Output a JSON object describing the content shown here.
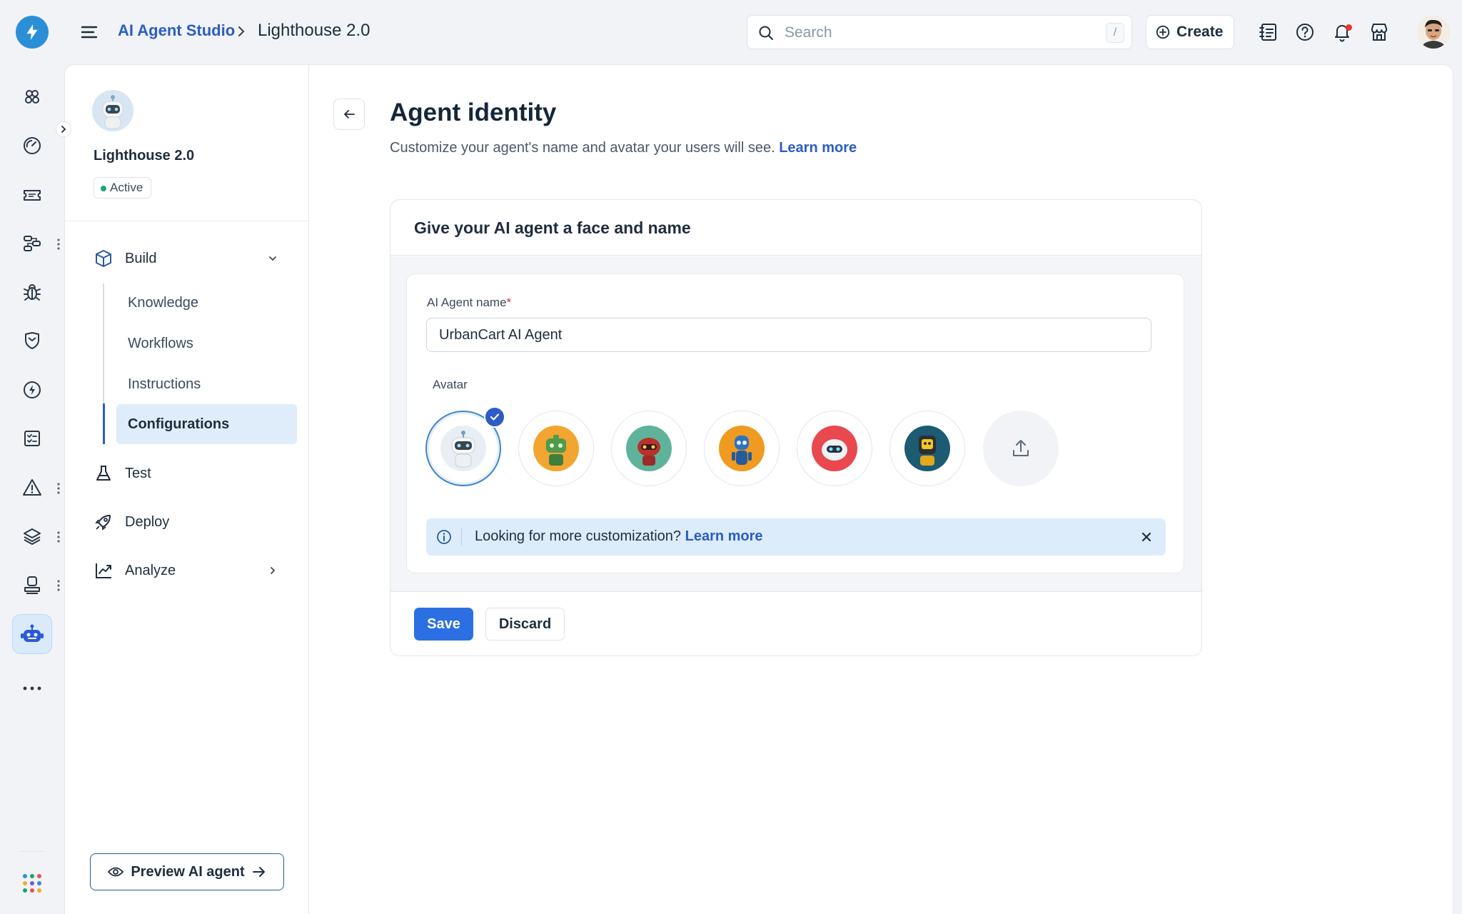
{
  "app": {
    "title": "AI Agent Studio",
    "breadcrumb_current": "Lighthouse 2.0",
    "brand_color": "#2b8fd8",
    "accent_color": "#2c5cc5"
  },
  "topbar": {
    "search_placeholder": "Search",
    "search_shortcut": "/",
    "create_label": "Create",
    "icons": [
      "contacts-icon",
      "help-icon",
      "bell-icon",
      "store-icon"
    ]
  },
  "rail": {
    "icons": [
      "integrations-icon",
      "dashboard-icon",
      "tickets-icon",
      "workflow-icon",
      "bug-icon",
      "shield-icon",
      "billing-icon",
      "tasks-icon",
      "alert-icon",
      "layers-icon",
      "stamp-icon",
      "bot-icon",
      "more-icon"
    ],
    "active": "bot-icon"
  },
  "agent": {
    "name": "Lighthouse 2.0",
    "status": "Active",
    "status_color": "#17a577"
  },
  "subnav": {
    "build": "Build",
    "items": [
      "Knowledge",
      "Workflows",
      "Instructions",
      "Configurations"
    ],
    "active_item": "Configurations",
    "test": "Test",
    "deploy": "Deploy",
    "analyze": "Analyze",
    "preview_button": "Preview AI agent"
  },
  "page": {
    "title": "Agent identity",
    "subtitle": "Customize your agent's name and avatar your users will see.",
    "subtitle_link": "Learn more"
  },
  "card": {
    "header": "Give your AI agent a face and name",
    "name_label": "AI Agent name",
    "required_mark": "*",
    "name_value": "UrbanCart AI Agent",
    "avatar_label": "Avatar",
    "avatars": [
      {
        "name": "white-robot",
        "color": "#e8eef4",
        "selected": true
      },
      {
        "name": "green-robot",
        "color": "#f2a531",
        "selected": false
      },
      {
        "name": "red-robot",
        "color": "#5fb39a",
        "selected": false
      },
      {
        "name": "blue-robot",
        "color": "#f09a22",
        "selected": false
      },
      {
        "name": "ghost-robot",
        "color": "#e8484e",
        "selected": false
      },
      {
        "name": "yellow-robot",
        "color": "#1d5b73",
        "selected": false
      }
    ],
    "info_text": "Looking for more customization?",
    "info_link": "Learn more",
    "save_label": "Save",
    "discard_label": "Discard"
  }
}
